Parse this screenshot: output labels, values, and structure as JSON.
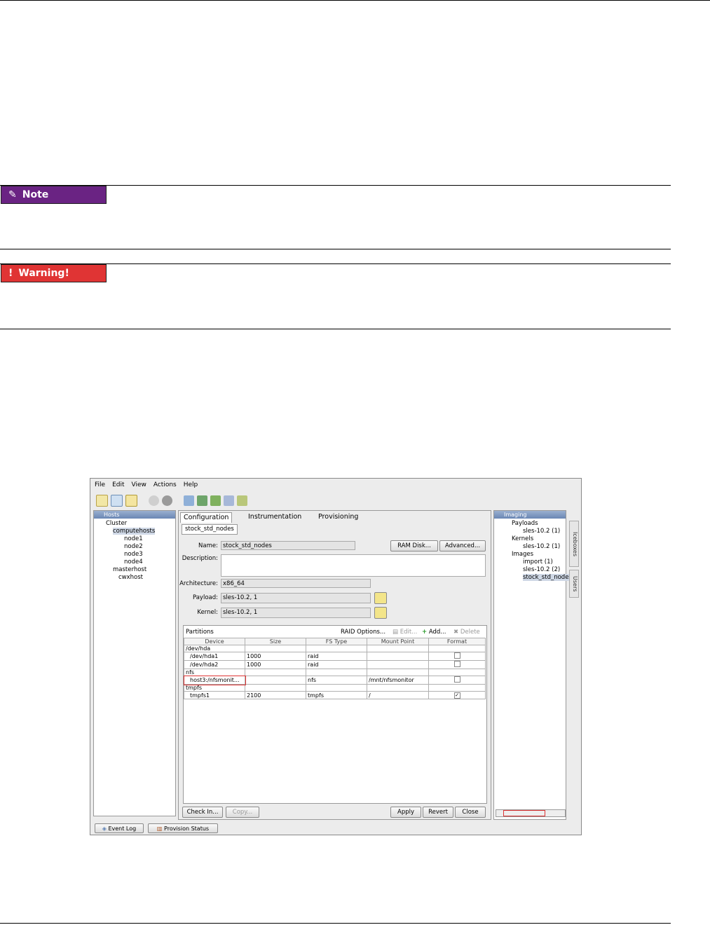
{
  "note": {
    "label": "Note",
    "icon": "pencil-icon",
    "color": "#6a2383"
  },
  "warning": {
    "label": "Warning!",
    "icon": "exclamation-icon",
    "color": "#e03434"
  },
  "app": {
    "menu": [
      "File",
      "Edit",
      "View",
      "Actions",
      "Help"
    ],
    "hosts_panel": {
      "title": "Hosts",
      "tree": [
        "Cluster",
        "computehosts",
        "node1",
        "node2",
        "node3",
        "node4",
        "masterhost",
        "cwxhost"
      ]
    },
    "tabs": [
      "Configuration",
      "Instrumentation",
      "Provisioning"
    ],
    "subtab": "stock_std_nodes",
    "form": {
      "name_label": "Name:",
      "name_value": "stock_std_nodes",
      "ramdisk_button": "RAM Disk...",
      "advanced_button": "Advanced...",
      "description_label": "Description:",
      "architecture_label": "Architecture:",
      "architecture_value": "x86_64",
      "payload_label": "Payload:",
      "payload_value": "sles-10.2, 1",
      "kernel_label": "Kernel:",
      "kernel_value": "sles-10.2, 1"
    },
    "partitions": {
      "title": "Partitions",
      "raid_button": "RAID Options...",
      "edit_button": "Edit...",
      "add_button": "Add...",
      "delete_button": "Delete",
      "columns": [
        "Device",
        "Size",
        "FS Type",
        "Mount Point",
        "Format"
      ],
      "rows": [
        [
          "/dev/hda",
          "",
          "",
          "",
          ""
        ],
        [
          "/dev/hda1",
          "1000",
          "raid",
          "",
          "off"
        ],
        [
          "/dev/hda2",
          "1000",
          "raid",
          "",
          "off"
        ],
        [
          "nfs",
          "",
          "",
          "",
          ""
        ],
        [
          "host3:/nfsmonit...",
          "",
          "nfs",
          "/mnt/nfsmonitor",
          "off"
        ],
        [
          "tmpfs",
          "",
          "",
          "",
          ""
        ],
        [
          "tmpfs1",
          "2100",
          "tmpfs",
          "/",
          "on"
        ]
      ]
    },
    "bottom_buttons": {
      "checkin": "Check In...",
      "copy": "Copy...",
      "apply": "Apply",
      "revert": "Revert",
      "close": "Close"
    },
    "imaging_panel": {
      "title": "Imaging",
      "tree": [
        "Payloads",
        "sles-10.2 (1)",
        "Kernels",
        "sles-10.2 (1)",
        "Images",
        "import (1)",
        "sles-10.2 (2)",
        "stock_std_nodes"
      ]
    },
    "side_tabs": [
      "Iceboxes",
      "Users"
    ],
    "status_tabs": [
      "Event Log",
      "Provision Status"
    ]
  }
}
